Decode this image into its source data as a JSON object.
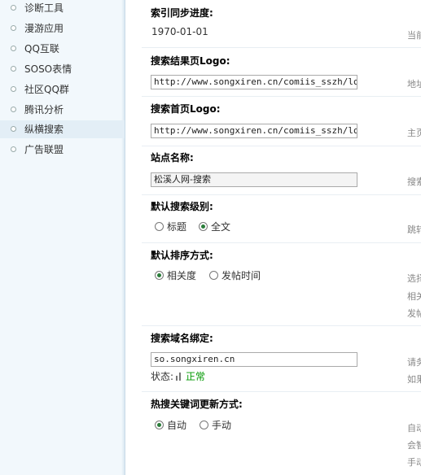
{
  "sidebar": {
    "items": [
      {
        "label": "诊断工具"
      },
      {
        "label": "漫游应用"
      },
      {
        "label": "QQ互联"
      },
      {
        "label": "SOSO表情"
      },
      {
        "label": "社区QQ群"
      },
      {
        "label": "腾讯分析"
      },
      {
        "label": "纵横搜索"
      },
      {
        "label": "广告联盟"
      }
    ]
  },
  "form": {
    "sync_progress": {
      "title": "索引同步进度:",
      "value": "1970-01-01",
      "hint": "当前"
    },
    "result_logo": {
      "title": "搜索结果页Logo:",
      "value": "http://www.songxiren.cn/comiis_sszh/logo.",
      "hint": "地址"
    },
    "home_logo": {
      "title": "搜索首页Logo:",
      "value": "http://www.songxiren.cn/comiis_sszh/logo.",
      "hint": "主页"
    },
    "site_name": {
      "title": "站点名称:",
      "value": "松溪人网-搜索",
      "hint": "搜索"
    },
    "search_level": {
      "title": "默认搜索级别:",
      "opt1": "标题",
      "opt2": "全文",
      "hint": "跳转"
    },
    "sort_order": {
      "title": "默认排序方式:",
      "opt1": "相关度",
      "opt2": "发帖时间",
      "hint1": "选择",
      "hint2": "相关",
      "hint3": "发帖"
    },
    "domain_bind": {
      "title": "搜索域名绑定:",
      "value": "so.songxiren.cn",
      "status_label": "状态:",
      "status_value": "正常",
      "hint1": "请务",
      "hint2": "如果"
    },
    "hot_update": {
      "title": "热搜关键词更新方式:",
      "opt1": "自动",
      "opt2": "手动",
      "hint1": "自动",
      "hint2": "会智",
      "hint3": "手动"
    }
  },
  "colors": {
    "sidebar_bg": "#f2f8fc",
    "active_bg": "#e3eef6",
    "status_ok": "#009900"
  }
}
